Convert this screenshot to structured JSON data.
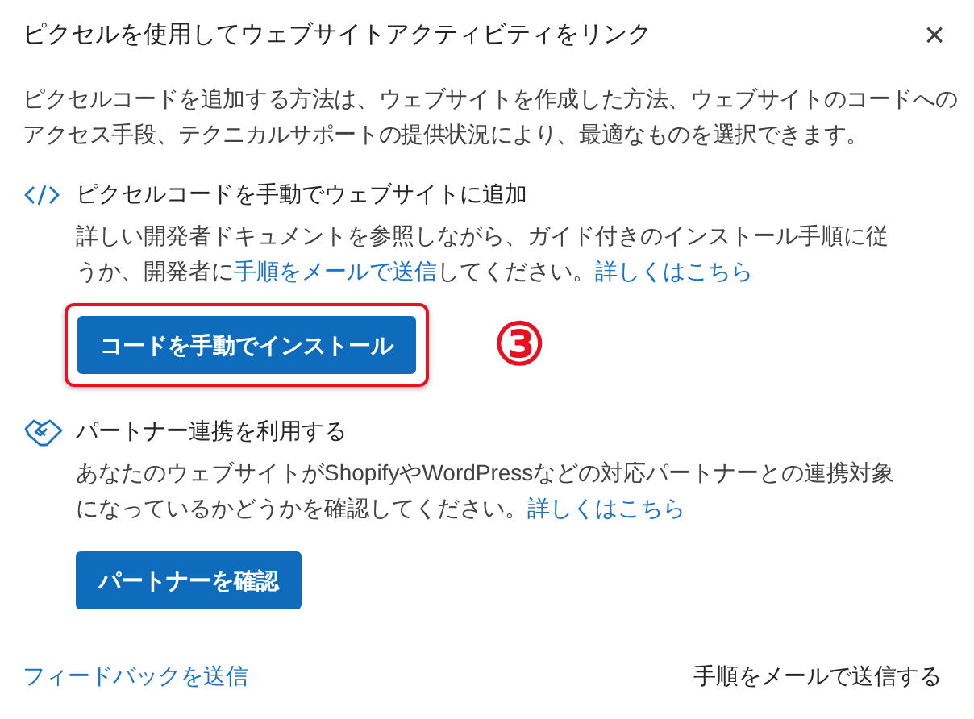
{
  "dialog": {
    "title": "ピクセルを使用してウェブサイトアクティビティをリンク",
    "close": "×"
  },
  "intro": "ピクセルコードを追加する方法は、ウェブサイトを作成した方法、ウェブサイトのコードへのアクセス手段、テクニカルサポートの提供状況により、最適なものを選択できます。",
  "sections": [
    {
      "kind": "code",
      "heading": "ピクセルコードを手動でウェブサイトに追加",
      "description": [
        {
          "kind": "text",
          "text": "詳しい開発者ドキュメントを参照しながら、ガイド付きのインストール手順に従うか、開発者に"
        },
        {
          "kind": "link",
          "text": "手順をメールで送信"
        },
        {
          "kind": "text",
          "text": "してください。"
        },
        {
          "kind": "link",
          "text": "詳しくはこちら"
        }
      ],
      "button": "コードを手動でインストール",
      "highlighted": true,
      "annotation": "③"
    },
    {
      "kind": "handshake",
      "heading": "パートナー連携を利用する",
      "description": [
        {
          "kind": "text",
          "text": "あなたのウェブサイトがShopifyやWordPressなどの対応パートナーとの連携対象になっているかどうかを確認してください。"
        },
        {
          "kind": "link",
          "text": "詳しくはこちら"
        }
      ],
      "button": "パートナーを確認",
      "highlighted": false
    }
  ],
  "footer": {
    "feedback_link": "フィードバックを送信",
    "email_button": "手順をメールで送信する"
  }
}
